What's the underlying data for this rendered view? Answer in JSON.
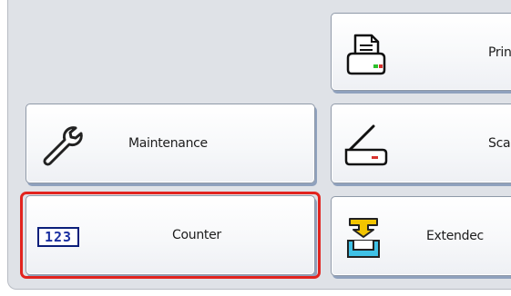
{
  "menu": {
    "buttons": [
      {
        "id": "printer",
        "label": "Prin",
        "icon": "printer-icon"
      },
      {
        "id": "maintenance",
        "label": "Maintenance",
        "icon": "wrench-icon"
      },
      {
        "id": "scanner",
        "label": "Scar",
        "icon": "scanner-icon"
      },
      {
        "id": "counter",
        "label": "Counter",
        "icon": "counter-icon",
        "icon_text": "123",
        "selected": true
      },
      {
        "id": "extended",
        "label": "Extendec",
        "icon": "extended-features-icon"
      }
    ]
  },
  "colors": {
    "panel_background": "#dfe2e7",
    "selection_outline": "#e2241f",
    "counter_icon_blue": "#1a2fa0",
    "extended_icon_yellow": "#f2c400",
    "extended_icon_cyan": "#3fc1e6",
    "indicator_green": "#2bbf2b",
    "indicator_red": "#d8332e"
  }
}
